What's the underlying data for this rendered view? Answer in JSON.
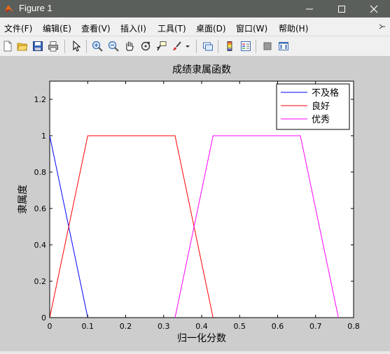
{
  "window": {
    "title": "Figure 1"
  },
  "menu": {
    "items": [
      "文件(F)",
      "编辑(E)",
      "查看(V)",
      "插入(I)",
      "工具(T)",
      "桌面(D)",
      "窗口(W)",
      "帮助(H)"
    ]
  },
  "toolbar": {
    "buttons": [
      "new-figure",
      "open-file",
      "save",
      "print",
      "edit-plot-arrow",
      "zoom-in",
      "zoom-out",
      "pan",
      "rotate-3d",
      "data-cursor",
      "brush",
      "link-plot",
      "colorbar",
      "legend",
      "hide-plot-tools",
      "show-plot-tools"
    ]
  },
  "chart_data": {
    "type": "line",
    "title": "成绩隶属函数",
    "xlabel": "归一化分数",
    "ylabel": "隶属度",
    "xlim": [
      0,
      0.8
    ],
    "ylim": [
      0,
      1.3
    ],
    "xticks": [
      "0",
      "0.1",
      "0.2",
      "0.3",
      "0.4",
      "0.5",
      "0.6",
      "0.7",
      "0.8"
    ],
    "yticks": [
      "0",
      "0.2",
      "0.4",
      "0.6",
      "0.8",
      "1",
      "1.2"
    ],
    "grid": false,
    "legend_position": "top-right",
    "series": [
      {
        "name": "不及格",
        "color": "#0000ff",
        "x": [
          0,
          0.1
        ],
        "y": [
          1,
          0
        ]
      },
      {
        "name": "良好",
        "color": "#ff0000",
        "x": [
          0,
          0.1,
          0.33,
          0.43
        ],
        "y": [
          0,
          1,
          1,
          0
        ]
      },
      {
        "name": "优秀",
        "color": "#ff00ff",
        "x": [
          0.33,
          0.43,
          0.66,
          0.76
        ],
        "y": [
          0,
          1,
          1,
          0
        ]
      }
    ]
  }
}
